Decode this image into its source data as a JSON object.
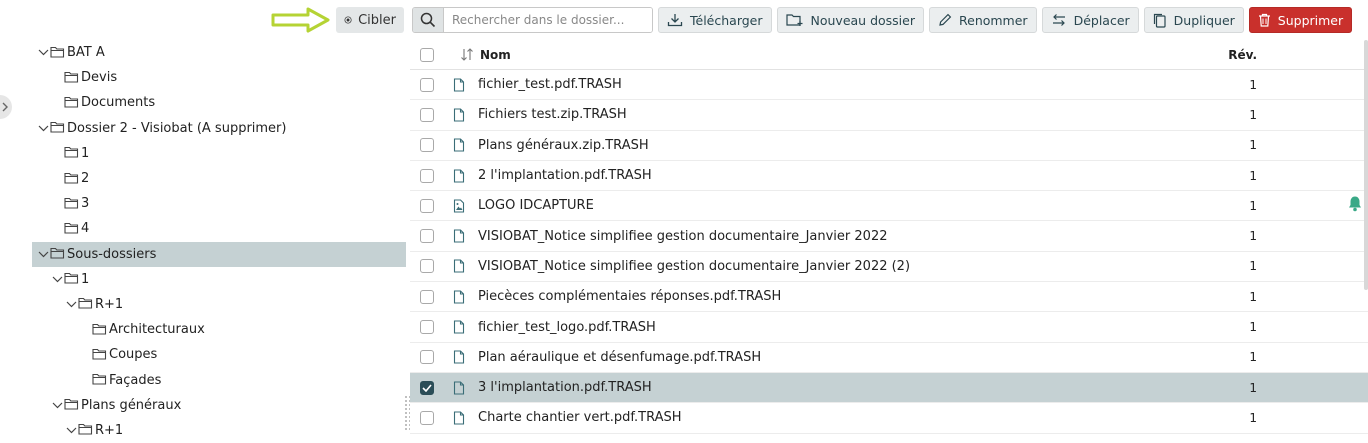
{
  "cibler_label": "Cibler",
  "tree": [
    {
      "label": "BAT A",
      "level": 0,
      "expanded": true
    },
    {
      "label": "Devis",
      "level": 1
    },
    {
      "label": "Documents",
      "level": 1
    },
    {
      "label": "Dossier 2 - Visiobat (A supprimer)",
      "level": 0,
      "expanded": true
    },
    {
      "label": "1",
      "level": 1
    },
    {
      "label": "2",
      "level": 1
    },
    {
      "label": "3",
      "level": 1
    },
    {
      "label": "4",
      "level": 1
    },
    {
      "label": "Sous-dossiers",
      "level": 0,
      "expanded": true,
      "selected": true
    },
    {
      "label": "1",
      "level": 1,
      "expanded": true
    },
    {
      "label": "R+1",
      "level": 2,
      "expanded": true
    },
    {
      "label": "Architecturaux",
      "level": 3
    },
    {
      "label": "Coupes",
      "level": 3
    },
    {
      "label": "Façades",
      "level": 3
    },
    {
      "label": "Plans généraux",
      "level": 1,
      "expanded": true
    },
    {
      "label": "R+1",
      "level": 2,
      "expanded": true
    }
  ],
  "toolbar": {
    "search_placeholder": "Rechercher dans le dossier...",
    "download_label": "Télécharger",
    "new_folder_label": "Nouveau dossier",
    "rename_label": "Renommer",
    "move_label": "Déplacer",
    "duplicate_label": "Dupliquer",
    "delete_label": "Supprimer"
  },
  "table": {
    "col_name": "Nom",
    "col_rev": "Rév.",
    "rows": [
      {
        "name": "fichier_test.pdf.TRASH",
        "rev": "1",
        "icon": "file-icon",
        "checked": false
      },
      {
        "name": "Fichiers test.zip.TRASH",
        "rev": "1",
        "icon": "file-icon",
        "checked": false
      },
      {
        "name": "Plans généraux.zip.TRASH",
        "rev": "1",
        "icon": "file-icon",
        "checked": false
      },
      {
        "name": "2 l'implantation.pdf.TRASH",
        "rev": "1",
        "icon": "file-icon",
        "checked": false
      },
      {
        "name": "LOGO IDCAPTURE",
        "rev": "1",
        "icon": "image-file-icon",
        "checked": false,
        "bell": true
      },
      {
        "name": "VISIOBAT_Notice simplifiee gestion documentaire_Janvier 2022",
        "rev": "1",
        "icon": "file-icon",
        "checked": false
      },
      {
        "name": "VISIOBAT_Notice simplifiee gestion documentaire_Janvier 2022 (2)",
        "rev": "1",
        "icon": "file-icon",
        "checked": false
      },
      {
        "name": "Piecèces complémentaies réponses.pdf.TRASH",
        "rev": "1",
        "icon": "file-icon",
        "checked": false
      },
      {
        "name": "fichier_test_logo.pdf.TRASH",
        "rev": "1",
        "icon": "file-icon",
        "checked": false
      },
      {
        "name": "Plan aéraulique et désenfumage.pdf.TRASH",
        "rev": "1",
        "icon": "file-icon",
        "checked": false
      },
      {
        "name": "3 l'implantation.pdf.TRASH",
        "rev": "1",
        "icon": "file-icon",
        "checked": true
      },
      {
        "name": "Charte chantier vert.pdf.TRASH",
        "rev": "1",
        "icon": "file-icon",
        "checked": false
      }
    ]
  },
  "colors": {
    "selected_row": "#c5d1d3",
    "danger": "#c9302c",
    "arrow": "#b5d334",
    "bell": "#3aa987"
  }
}
